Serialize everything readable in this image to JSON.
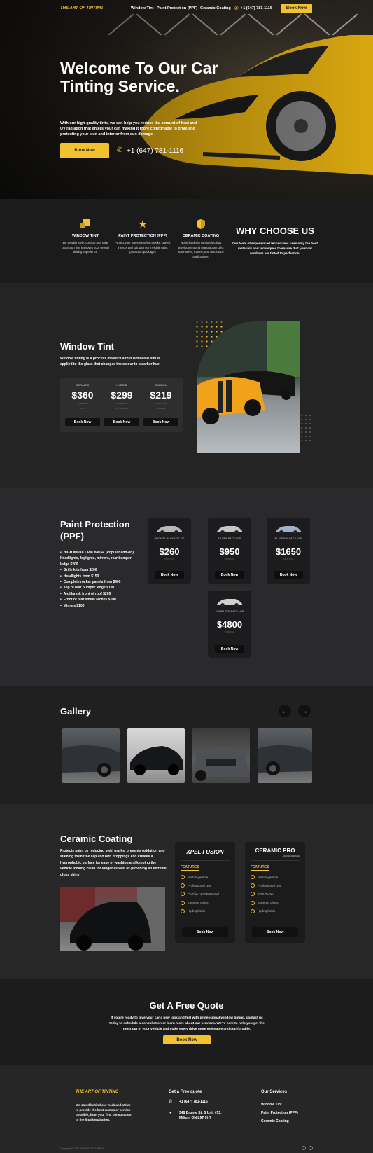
{
  "nav": {
    "logo": "THE ART OF TINTING",
    "links": [
      "Window Tint",
      "Paint Protection (PPF)",
      "Ceramic Coating"
    ],
    "phone": "+1 (647) 781-1116",
    "cta": "Book Now"
  },
  "hero": {
    "title": "Welcome To Our Car Tinting Service.",
    "description": "With our high-quality tints, we can help you reduce the amount of heat and UV radiation that enters your car, making it more comfortable to drive and protecting your skin and interior from sun damage.",
    "cta": "Book Now",
    "phone": "+1 (647) 781-1116"
  },
  "why": {
    "items": [
      {
        "title": "WINDOW TINT",
        "desc": "We provide style, comfort and solar protection that improves your overall driving experience",
        "icon": "window-tint-icon"
      },
      {
        "title": "PAINT PROTECTION (PPF)",
        "desc": "Protect your investment from rocks, gravel, insects and salt with our invisible paint protection packages",
        "icon": "star-icon"
      },
      {
        "title": "CERAMIC COATING",
        "desc": "World leader in nanotechnology development and manufacturing for automotive, marine, and aerospace applications.",
        "icon": "shield-icon"
      }
    ],
    "heading": "WHY CHOOSE US",
    "text": "Our team of experienced technicians uses only the best materials and techniques to ensure that your car windows are tinted to perfection."
  },
  "tint": {
    "heading": "Window Tint",
    "text": "Window tinting is a process in which a thin laminated film is applied to the glass that changes the colour to a darker hue.",
    "packages": [
      {
        "label": "CERAMIC",
        "price": "$360",
        "sub": "STARTING",
        "sub2": "CIR",
        "cta": "Book Now"
      },
      {
        "label": "HYBRID",
        "price": "$299",
        "sub": "STARTING",
        "sub2": "HP SUATHE",
        "cta": "Book Now"
      },
      {
        "label": "CARBON",
        "price": "$219",
        "sub": "STARTING",
        "sub2": "CARBON",
        "cta": "Book Now"
      }
    ]
  },
  "ppf": {
    "heading": "Paint Protection (PPF)",
    "addons": [
      "HIGH IMPACT PACKAGE (Popular add-on): Headlights, foglights, mirrors, rear bumper ledge $200",
      "Grille kits from $200",
      "Headlights from $150",
      "Complete rocker panels from $400",
      "Top of rear bumper ledge $100",
      "A-pillars & front of roof $200",
      "Front of rear wheel arches $100",
      "Mirrors $100"
    ],
    "packages": [
      {
        "label": "BRONZE PACKAGE 18\"",
        "price": "$260",
        "sub": "STARTING",
        "cta": "Book Now",
        "car_color": "#b8b8b8"
      },
      {
        "label": "SILVER PACKAGE",
        "price": "$950",
        "sub": "STARTING",
        "cta": "Book Now",
        "car_color": "#c7c7c7"
      },
      {
        "label": "PLATINUM PACKAGE",
        "price": "$1650",
        "sub": "STARTING",
        "cta": "Book Now",
        "car_color": "#9fb2c9"
      },
      {
        "label": "COMPLETE PACKAGE",
        "price": "$4800",
        "sub": "STARTING",
        "cta": "Book Now",
        "car_color": "#d0d0d0"
      }
    ]
  },
  "gallery": {
    "heading": "Gallery",
    "prev": "←",
    "next": "→"
  },
  "ceramic": {
    "heading": "Ceramic Coating",
    "text": "Protects paint by reducing swirl marks, prevents oxidation and staining from tree sap and bird droppings and creates a hydrophobic surface for ease of washing and keeping the vehicle looking clean for longer as well as providing an extreme gloss shine!",
    "cards": [
      {
        "brand": "XPEL FUSION",
        "features_label": "FEATURES",
        "features": [
          "Multi-layerable",
          "Professional Use",
          "Certified and Patented",
          "Extreme Gloss",
          "Hydrophobic"
        ],
        "cta": "Book Now"
      },
      {
        "brand": "CERAMIC PRO",
        "brand_sub": "MISSISSAUGA",
        "features_label": "FEATURES",
        "features": [
          "Multi-layerable",
          "Professional Use",
          "SGS Tested",
          "Extreme Gloss",
          "Hydrophobic"
        ],
        "cta": "Book Now"
      }
    ]
  },
  "quote": {
    "heading": "Get A Free Quote",
    "text": "If you're ready to give your car a new look and feel with professional window tinting, contact us today to schedule a consultation or learn more about our services. We're here to help you get the most out of your vehicle and make every drive more enjoyable and comfortable.",
    "cta": "Book Now"
  },
  "footer": {
    "logo": "THE ART OF TINTING",
    "about": "We stand behind our work and strive to provide the best customer service possible, from your first consultation to the final installation.",
    "quote_heading": "Get a Free quote",
    "phone": "+1 (647) 781-1116",
    "address": "348 Bronte St. S Unit #15, Milton, ON L9T 0H7",
    "services_heading": "Our Services",
    "services": [
      "Window Tint",
      "Paint Protection (PPF)",
      "Ceramic Coating"
    ],
    "copyright": "Copyright © 2023 THE ART OF TINTING"
  },
  "colors": {
    "accent": "#f2c12e",
    "bg_dark": "#1b1b1b"
  }
}
